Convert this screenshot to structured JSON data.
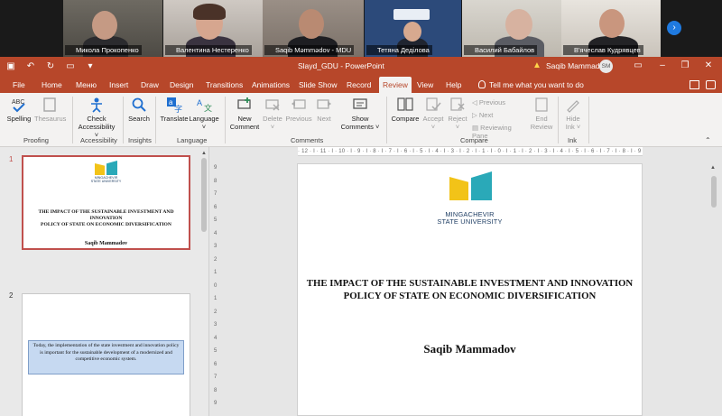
{
  "meeting": {
    "participants": [
      {
        "name": "Микола Прокопенко",
        "active": false
      },
      {
        "name": "Валентина Нестеренко",
        "active": false
      },
      {
        "name": "Saqib Məmmədov - MDU",
        "active": true
      },
      {
        "name": "Тетяна Дедiлова",
        "active": false
      },
      {
        "name": "Василий Бабайлов",
        "active": false
      },
      {
        "name": "В'ячеслав Кудрявцев",
        "active": false
      }
    ],
    "next_icon": "chevron-right-icon"
  },
  "titlebar": {
    "doc_title": "Slayd_GDU  -  PowerPoint",
    "user_name": "Saqib Mammadov",
    "avatar_initials": "SM",
    "accent": "#b7472a"
  },
  "tabs": [
    "File",
    "Home",
    "Меню",
    "Insert",
    "Draw",
    "Design",
    "Transitions",
    "Animations",
    "Slide Show",
    "Record",
    "Review",
    "View",
    "Help"
  ],
  "selected_tab": "Review",
  "tell_me": "Tell me what you want to do",
  "ribbon": {
    "spelling": "Spelling",
    "thesaurus": "Thesaurus",
    "check_accessibility": [
      "Check",
      "Accessibility ˅"
    ],
    "search": "Search",
    "translate": "Translate",
    "language": [
      "Language",
      "˅"
    ],
    "new_comment": [
      "New",
      "Comment"
    ],
    "delete": [
      "Delete",
      "˅"
    ],
    "previous": "Previous",
    "next": "Next",
    "show_comments": [
      "Show",
      "Comments ˅"
    ],
    "compare": "Compare",
    "accept": [
      "Accept",
      "˅"
    ],
    "reject": [
      "Reject",
      "˅"
    ],
    "compare_previous": "Previous",
    "compare_next": "Next",
    "reviewing_pane": "Reviewing Pane",
    "end_review": [
      "End",
      "Review"
    ],
    "hide_ink": [
      "Hide",
      "Ink ˅"
    ],
    "groups": {
      "proofing": "Proofing",
      "accessibility": "Accessibility",
      "insights": "Insights",
      "language": "Language",
      "comments": "Comments",
      "compare": "Compare",
      "ink": "Ink"
    }
  },
  "slides": [
    {
      "number": "1",
      "logo_caption": [
        "MINGACHEVIR",
        "STATE UNIVERSITY"
      ],
      "title": [
        "THE IMPACT OF THE SUSTAINABLE INVESTMENT AND INNOVATION",
        "POLICY OF STATE ON ECONOMIC DIVERSIFICATION"
      ],
      "author": "Saqib Mammadov"
    },
    {
      "number": "2",
      "box_text": "Today, the implementation of the state investment and innovation policy is important for the sustainable development of a modernized and competitive economic system."
    }
  ],
  "editor": {
    "logo_caption": [
      "MINGACHEVIR",
      "STATE UNIVERSITY"
    ],
    "title": [
      "THE IMPACT OF THE SUSTAINABLE INVESTMENT AND INNOVATION",
      "POLICY OF STATE ON ECONOMIC DIVERSIFICATION"
    ],
    "author": "Saqib Mammadov",
    "ruler_h": "· 12 · I · 11 · I · 10 · I · 9 · I · 8 · I · 7 · I · 6 · I · 5 · I · 4 · I · 3 · I · 2 · I · 1 · I · 0 · I · 1 · I · 2 · I · 3 · I · 4 · I · 5 · I · 6 · I · 7 · I · 8 · I · 9 · I · 10 · I · 11 · I · 12 ·",
    "ruler_v": [
      "9",
      "8",
      "7",
      "6",
      "5",
      "4",
      "3",
      "2",
      "1",
      "0",
      "1",
      "2",
      "3",
      "4",
      "5",
      "6",
      "7",
      "8",
      "9"
    ]
  },
  "logo_colors": {
    "yellow": "#f2c318",
    "teal": "#2aa9b8"
  }
}
